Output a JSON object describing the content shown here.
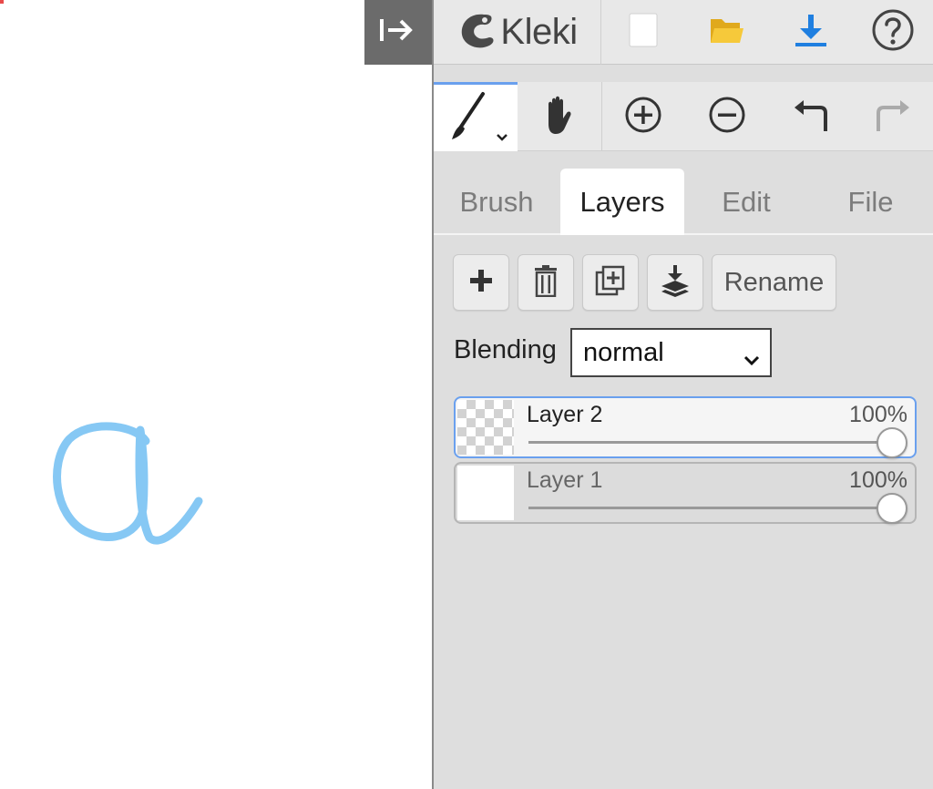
{
  "app": {
    "name": "Kleki"
  },
  "canvas": {
    "drawn_letter": "a",
    "stroke_color": "#86c8f4",
    "marker_color": "#e84a4a"
  },
  "collapse_button": {
    "icon": "arrow-right-to-bar-icon"
  },
  "top_bar": {
    "items": [
      {
        "icon": "new-file-icon"
      },
      {
        "icon": "open-folder-icon",
        "color": "#f2c230"
      },
      {
        "icon": "download-icon",
        "color": "#1f7fe0"
      },
      {
        "icon": "help-icon"
      }
    ]
  },
  "tool_bar": {
    "items": [
      {
        "icon": "brush-icon",
        "selected": true,
        "has_dropdown": true
      },
      {
        "icon": "hand-icon"
      },
      {
        "icon": "zoom-in-icon"
      },
      {
        "icon": "zoom-out-icon"
      },
      {
        "icon": "undo-icon"
      },
      {
        "icon": "redo-icon",
        "disabled": true
      }
    ]
  },
  "tabs": [
    {
      "label": "Brush"
    },
    {
      "label": "Layers",
      "active": true
    },
    {
      "label": "Edit"
    },
    {
      "label": "File"
    }
  ],
  "layer_actions": {
    "add_icon": "plus-icon",
    "delete_icon": "trash-icon",
    "duplicate_icon": "duplicate-icon",
    "merge_icon": "merge-down-icon",
    "rename_label": "Rename"
  },
  "blending": {
    "label": "Blending",
    "value": "normal"
  },
  "layers": [
    {
      "name": "Layer 2",
      "opacity": "100%",
      "opacity_value": 1.0,
      "selected": true,
      "thumb": "transparent"
    },
    {
      "name": "Layer 1",
      "opacity": "100%",
      "opacity_value": 1.0,
      "selected": false,
      "thumb": "white"
    }
  ],
  "colors": {
    "accent": "#6aa0ee",
    "panel": "#dedede",
    "collapse_button": "#6b6b6b"
  }
}
